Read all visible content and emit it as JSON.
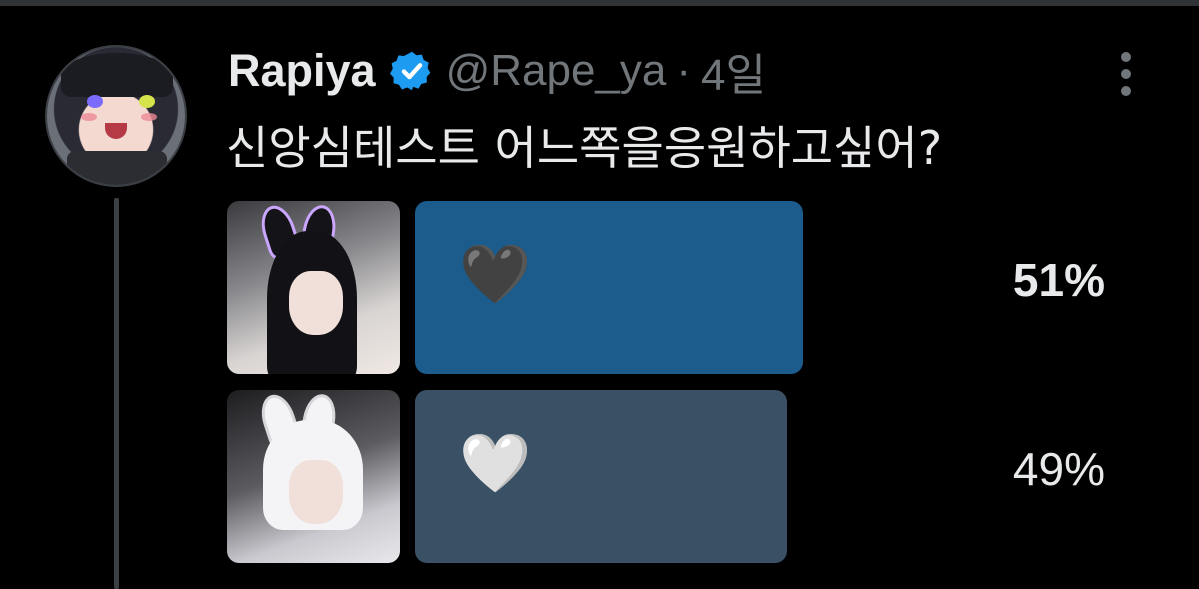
{
  "post": {
    "author_name": "Rapiya",
    "handle": "@Rape_ya",
    "separator": "·",
    "time": "4일",
    "text": "신앙심테스트 어느쪽을응원하고싶어?"
  },
  "poll": {
    "options": [
      {
        "label": "🖤",
        "percent": "51%",
        "share": 51,
        "color": "#1b5c8c"
      },
      {
        "label": "🤍",
        "percent": "49%",
        "share": 49,
        "color": "#3a5064"
      }
    ]
  },
  "icons": {
    "verified": "verified-badge-icon",
    "more": "more-options-icon"
  },
  "colors": {
    "background": "#000000",
    "verified": "#1d9bf0",
    "muted_text": "#71767b"
  }
}
